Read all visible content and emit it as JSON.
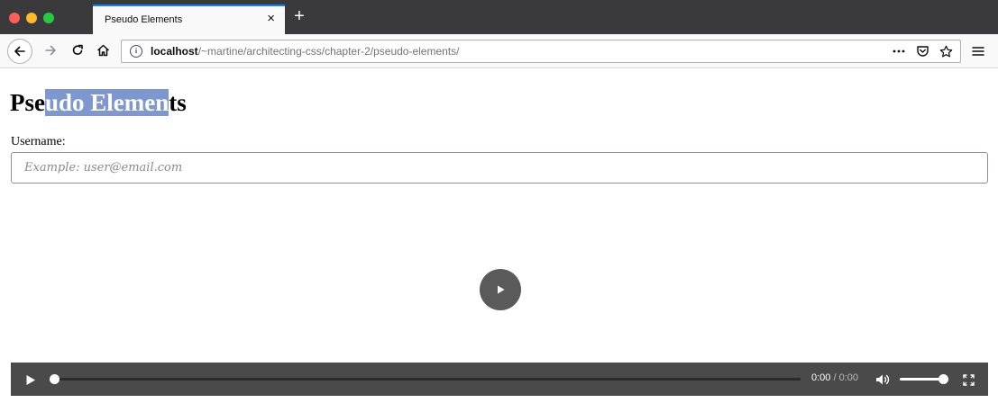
{
  "browser": {
    "tab": {
      "title": "Pseudo Elements",
      "close_glyph": "×"
    },
    "new_tab_glyph": "+",
    "url": {
      "host": "localhost",
      "path": "/~martine/architecting-css/chapter-2/pseudo-elements/"
    },
    "icons": {
      "back": "arrow-left-icon",
      "forward": "arrow-right-icon",
      "reload": "reload-icon",
      "home": "home-icon",
      "site_info": "info-icon",
      "page_actions": "more-icon",
      "pocket": "pocket-icon",
      "bookmark": "star-icon",
      "menu": "hamburger-menu-icon"
    },
    "colors": {
      "tabstrip": "#3a3a3c",
      "accent": "#0a84ff"
    }
  },
  "page": {
    "title_parts": {
      "before": "Pse",
      "selected": "udo Elemen",
      "after": "ts"
    },
    "selection_color": "#7e97cf",
    "form": {
      "label": "Username:",
      "placeholder": "Example: user@email.com",
      "value": ""
    },
    "video": {
      "current_time": "0:00",
      "separator": " / ",
      "duration": "0:00",
      "progress": 0,
      "volume": 1,
      "icons": {
        "big_play": "play-icon",
        "play": "play-icon",
        "volume": "volume-icon",
        "fullscreen": "fullscreen-icon"
      }
    }
  }
}
